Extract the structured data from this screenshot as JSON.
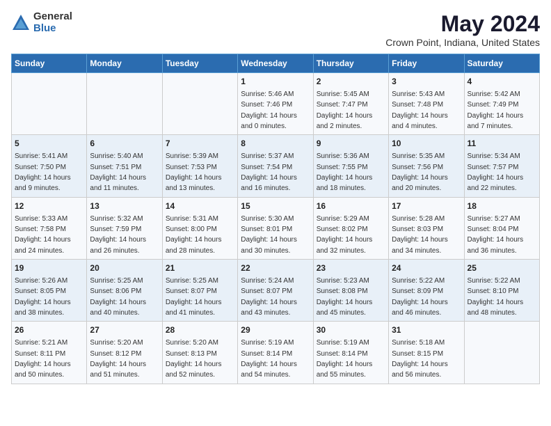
{
  "logo": {
    "general": "General",
    "blue": "Blue"
  },
  "title": "May 2024",
  "subtitle": "Crown Point, Indiana, United States",
  "days_of_week": [
    "Sunday",
    "Monday",
    "Tuesday",
    "Wednesday",
    "Thursday",
    "Friday",
    "Saturday"
  ],
  "weeks": [
    [
      {
        "day": "",
        "info": ""
      },
      {
        "day": "",
        "info": ""
      },
      {
        "day": "",
        "info": ""
      },
      {
        "day": "1",
        "info": "Sunrise: 5:46 AM\nSunset: 7:46 PM\nDaylight: 14 hours\nand 0 minutes."
      },
      {
        "day": "2",
        "info": "Sunrise: 5:45 AM\nSunset: 7:47 PM\nDaylight: 14 hours\nand 2 minutes."
      },
      {
        "day": "3",
        "info": "Sunrise: 5:43 AM\nSunset: 7:48 PM\nDaylight: 14 hours\nand 4 minutes."
      },
      {
        "day": "4",
        "info": "Sunrise: 5:42 AM\nSunset: 7:49 PM\nDaylight: 14 hours\nand 7 minutes."
      }
    ],
    [
      {
        "day": "5",
        "info": "Sunrise: 5:41 AM\nSunset: 7:50 PM\nDaylight: 14 hours\nand 9 minutes."
      },
      {
        "day": "6",
        "info": "Sunrise: 5:40 AM\nSunset: 7:51 PM\nDaylight: 14 hours\nand 11 minutes."
      },
      {
        "day": "7",
        "info": "Sunrise: 5:39 AM\nSunset: 7:53 PM\nDaylight: 14 hours\nand 13 minutes."
      },
      {
        "day": "8",
        "info": "Sunrise: 5:37 AM\nSunset: 7:54 PM\nDaylight: 14 hours\nand 16 minutes."
      },
      {
        "day": "9",
        "info": "Sunrise: 5:36 AM\nSunset: 7:55 PM\nDaylight: 14 hours\nand 18 minutes."
      },
      {
        "day": "10",
        "info": "Sunrise: 5:35 AM\nSunset: 7:56 PM\nDaylight: 14 hours\nand 20 minutes."
      },
      {
        "day": "11",
        "info": "Sunrise: 5:34 AM\nSunset: 7:57 PM\nDaylight: 14 hours\nand 22 minutes."
      }
    ],
    [
      {
        "day": "12",
        "info": "Sunrise: 5:33 AM\nSunset: 7:58 PM\nDaylight: 14 hours\nand 24 minutes."
      },
      {
        "day": "13",
        "info": "Sunrise: 5:32 AM\nSunset: 7:59 PM\nDaylight: 14 hours\nand 26 minutes."
      },
      {
        "day": "14",
        "info": "Sunrise: 5:31 AM\nSunset: 8:00 PM\nDaylight: 14 hours\nand 28 minutes."
      },
      {
        "day": "15",
        "info": "Sunrise: 5:30 AM\nSunset: 8:01 PM\nDaylight: 14 hours\nand 30 minutes."
      },
      {
        "day": "16",
        "info": "Sunrise: 5:29 AM\nSunset: 8:02 PM\nDaylight: 14 hours\nand 32 minutes."
      },
      {
        "day": "17",
        "info": "Sunrise: 5:28 AM\nSunset: 8:03 PM\nDaylight: 14 hours\nand 34 minutes."
      },
      {
        "day": "18",
        "info": "Sunrise: 5:27 AM\nSunset: 8:04 PM\nDaylight: 14 hours\nand 36 minutes."
      }
    ],
    [
      {
        "day": "19",
        "info": "Sunrise: 5:26 AM\nSunset: 8:05 PM\nDaylight: 14 hours\nand 38 minutes."
      },
      {
        "day": "20",
        "info": "Sunrise: 5:25 AM\nSunset: 8:06 PM\nDaylight: 14 hours\nand 40 minutes."
      },
      {
        "day": "21",
        "info": "Sunrise: 5:25 AM\nSunset: 8:07 PM\nDaylight: 14 hours\nand 41 minutes."
      },
      {
        "day": "22",
        "info": "Sunrise: 5:24 AM\nSunset: 8:07 PM\nDaylight: 14 hours\nand 43 minutes."
      },
      {
        "day": "23",
        "info": "Sunrise: 5:23 AM\nSunset: 8:08 PM\nDaylight: 14 hours\nand 45 minutes."
      },
      {
        "day": "24",
        "info": "Sunrise: 5:22 AM\nSunset: 8:09 PM\nDaylight: 14 hours\nand 46 minutes."
      },
      {
        "day": "25",
        "info": "Sunrise: 5:22 AM\nSunset: 8:10 PM\nDaylight: 14 hours\nand 48 minutes."
      }
    ],
    [
      {
        "day": "26",
        "info": "Sunrise: 5:21 AM\nSunset: 8:11 PM\nDaylight: 14 hours\nand 50 minutes."
      },
      {
        "day": "27",
        "info": "Sunrise: 5:20 AM\nSunset: 8:12 PM\nDaylight: 14 hours\nand 51 minutes."
      },
      {
        "day": "28",
        "info": "Sunrise: 5:20 AM\nSunset: 8:13 PM\nDaylight: 14 hours\nand 52 minutes."
      },
      {
        "day": "29",
        "info": "Sunrise: 5:19 AM\nSunset: 8:14 PM\nDaylight: 14 hours\nand 54 minutes."
      },
      {
        "day": "30",
        "info": "Sunrise: 5:19 AM\nSunset: 8:14 PM\nDaylight: 14 hours\nand 55 minutes."
      },
      {
        "day": "31",
        "info": "Sunrise: 5:18 AM\nSunset: 8:15 PM\nDaylight: 14 hours\nand 56 minutes."
      },
      {
        "day": "",
        "info": ""
      }
    ]
  ]
}
